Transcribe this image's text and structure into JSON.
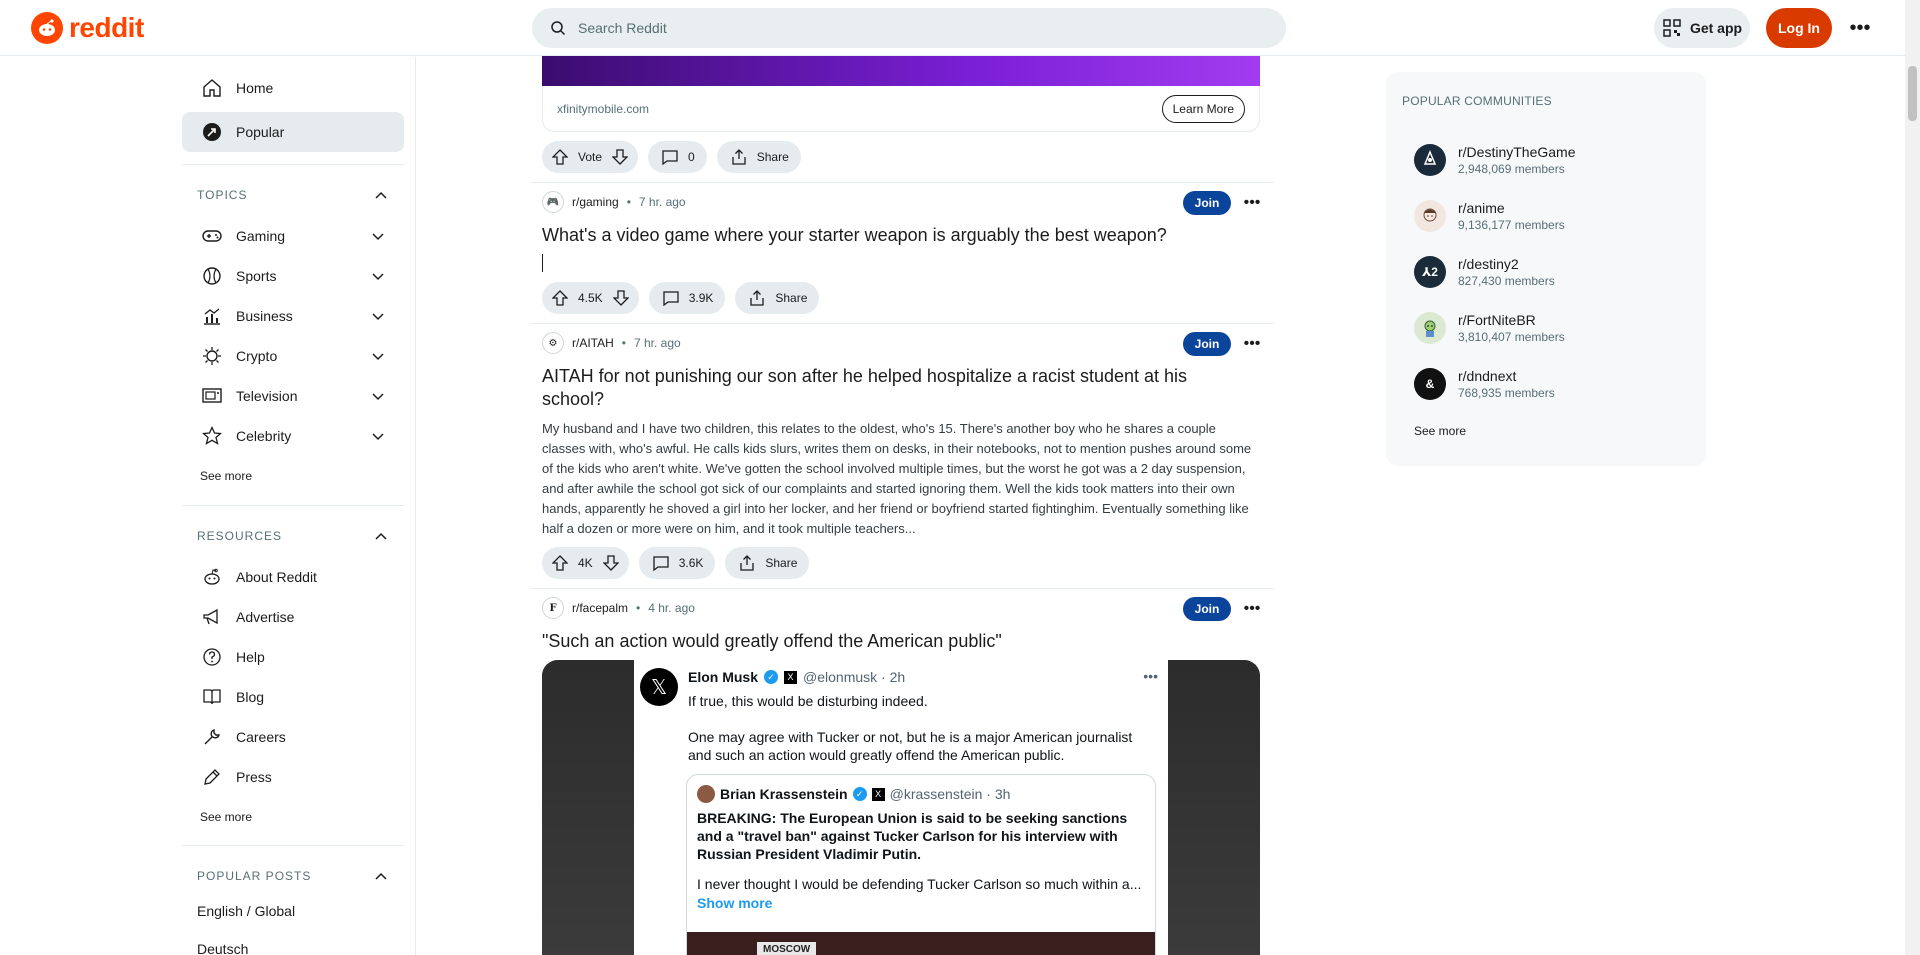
{
  "header": {
    "logo_text": "reddit",
    "search_placeholder": "Search Reddit",
    "get_app": "Get app",
    "login": "Log In"
  },
  "sidebar": {
    "nav": [
      {
        "label": "Home",
        "icon": "home-icon"
      },
      {
        "label": "Popular",
        "icon": "popular-icon",
        "active": true
      }
    ],
    "topics_title": "TOPICS",
    "topics": [
      {
        "label": "Gaming",
        "icon": "gamepad-icon"
      },
      {
        "label": "Sports",
        "icon": "sports-icon"
      },
      {
        "label": "Business",
        "icon": "chart-icon"
      },
      {
        "label": "Crypto",
        "icon": "crypto-icon"
      },
      {
        "label": "Television",
        "icon": "tv-icon"
      },
      {
        "label": "Celebrity",
        "icon": "star-icon"
      }
    ],
    "topics_see_more": "See more",
    "resources_title": "RESOURCES",
    "resources": [
      {
        "label": "About Reddit",
        "icon": "reddit-icon"
      },
      {
        "label": "Advertise",
        "icon": "megaphone-icon"
      },
      {
        "label": "Help",
        "icon": "help-icon"
      },
      {
        "label": "Blog",
        "icon": "book-icon"
      },
      {
        "label": "Careers",
        "icon": "wrench-icon"
      },
      {
        "label": "Press",
        "icon": "pen-icon"
      }
    ],
    "resources_see_more": "See more",
    "popular_posts_title": "POPULAR POSTS",
    "popular_posts": [
      "English / Global",
      "Deutsch"
    ]
  },
  "ad": {
    "domain": "xfinitymobile.com",
    "cta": "Learn More",
    "vote_label": "Vote",
    "comments": "0",
    "share": "Share"
  },
  "posts": [
    {
      "subreddit": "r/gaming",
      "time": "7 hr. ago",
      "join": "Join",
      "title": "What's a video game where your starter weapon is arguably the best weapon?",
      "votes": "4.5K",
      "comments": "3.9K",
      "share": "Share"
    },
    {
      "subreddit": "r/AITAH",
      "time": "7 hr. ago",
      "join": "Join",
      "title": "AITAH for not punishing our son after he helped hospitalize a racist student at his school?",
      "body": "My husband and I have two children, this relates to the oldest, who's 15. There's another boy who he shares a couple classes with, who's awful. He calls kids slurs, writes them on desks, in their notebooks, not to mention pushes around some of the kids who aren't white. We've gotten the school involved multiple times, but the worst he got was a 2 day suspension, and after awhile the school got sick of our complaints and started ignoring them. Well the kids took matters into their own hands, apparently he shoved a girl into her locker, and her friend or boyfriend started fightinghim. Eventually something like half a dozen or more were on him, and it took multiple teachers...",
      "votes": "4K",
      "comments": "3.6K",
      "share": "Share"
    },
    {
      "subreddit": "r/facepalm",
      "time": "4 hr. ago",
      "join": "Join",
      "title": "\"Such an action would greatly offend the American public\"",
      "tweet": {
        "name": "Elon Musk",
        "handle": "@elonmusk · 2h",
        "text1": "If true, this would be disturbing indeed.",
        "text2": "One may agree with Tucker or not, but he is a major American journalist and such an action would greatly offend the American public.",
        "quote_name": "Brian Krassenstein",
        "quote_handle": "@krassenstein · 3h",
        "quote_bold": "BREAKING:  The European Union is said to be seeking sanctions and a \"travel ban\" against Tucker Carlson for his interview with Russian President Vladimir Putin.",
        "quote_text": "I never thought I would be defending Tucker Carlson so much within a...",
        "show_more": "Show more",
        "media_tag": "MOSCOW"
      }
    }
  ],
  "right": {
    "title": "POPULAR COMMUNITIES",
    "communities": [
      {
        "name": "r/DestinyTheGame",
        "members": "2,948,069 members",
        "color": "#1a2a3a"
      },
      {
        "name": "r/anime",
        "members": "9,136,177 members",
        "color": "#f2e6e0"
      },
      {
        "name": "r/destiny2",
        "members": "827,430 members",
        "color": "#1c2b3a"
      },
      {
        "name": "r/FortNiteBR",
        "members": "3,810,407 members",
        "color": "#b7d5a8"
      },
      {
        "name": "r/dndnext",
        "members": "768,935 members",
        "color": "#111111"
      }
    ],
    "see_more": "See more"
  }
}
